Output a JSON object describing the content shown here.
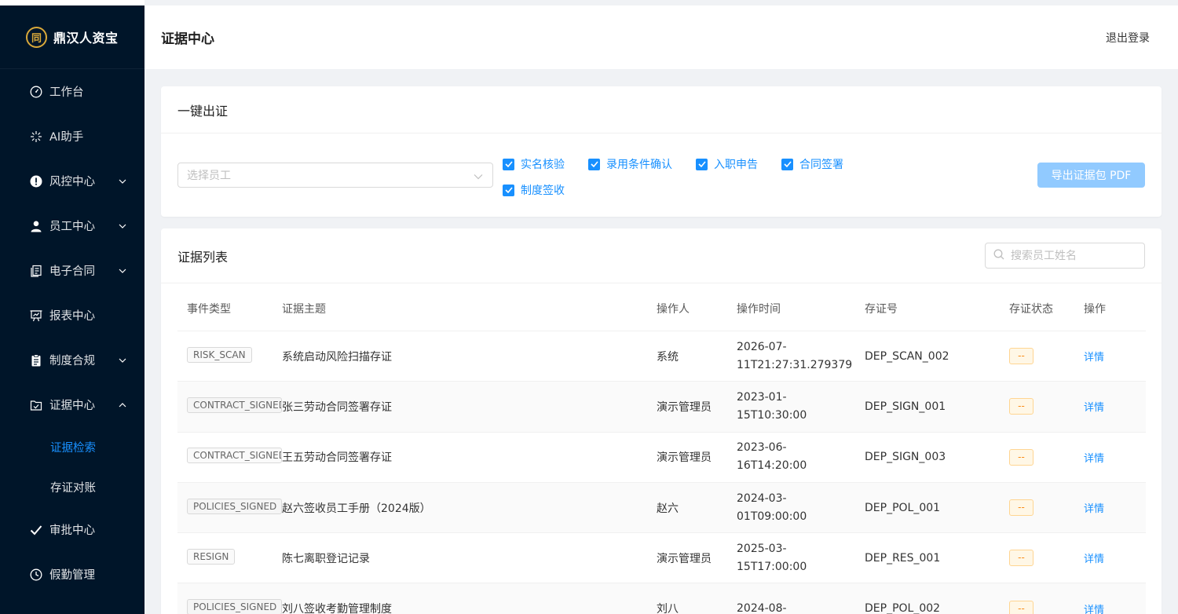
{
  "brand": {
    "logo_char": "同",
    "name": "鼎汉人资宝"
  },
  "sidebar": {
    "items": [
      {
        "label": "工作台",
        "icon": "dashboard-icon"
      },
      {
        "label": "AI助手",
        "icon": "sparkle-icon"
      },
      {
        "label": "风控中心",
        "icon": "alert-circle-icon"
      },
      {
        "label": "员工中心",
        "icon": "user-icon"
      },
      {
        "label": "电子合同",
        "icon": "contract-icon"
      },
      {
        "label": "报表中心",
        "icon": "report-icon"
      },
      {
        "label": "制度合规",
        "icon": "clipboard-icon"
      },
      {
        "label": "证据中心",
        "icon": "evidence-icon"
      },
      {
        "label": "审批中心",
        "icon": "check-icon"
      },
      {
        "label": "假勤管理",
        "icon": "clock-icon"
      }
    ],
    "sub": {
      "search": "证据检索",
      "ledger": "存证对账"
    }
  },
  "header": {
    "title": "证据中心",
    "logout": "退出登录"
  },
  "issue": {
    "title": "一键出证",
    "select_placeholder": "选择员工",
    "checks": [
      "实名核验",
      "录用条件确认",
      "入职申告",
      "合同签署",
      "制度签收"
    ],
    "export": "导出证据包 PDF"
  },
  "list": {
    "title": "证据列表",
    "search_placeholder": "搜索员工姓名",
    "columns": [
      "事件类型",
      "证据主题",
      "操作人",
      "操作时间",
      "存证号",
      "存证状态",
      "操作"
    ],
    "rows": [
      {
        "type": "RISK_SCAN",
        "subject": "系统启动风险扫描存证",
        "operator": "系统",
        "time1": "2026-07-",
        "time2": "11T21:27:31.279379",
        "id": "DEP_SCAN_002",
        "status": "--",
        "action": "详情"
      },
      {
        "type": "CONTRACT_SIGNED",
        "subject": "张三劳动合同签署存证",
        "operator": "演示管理员",
        "time1": "2023-01-",
        "time2": "15T10:30:00",
        "id": "DEP_SIGN_001",
        "status": "--",
        "action": "详情"
      },
      {
        "type": "CONTRACT_SIGNED",
        "subject": "王五劳动合同签署存证",
        "operator": "演示管理员",
        "time1": "2023-06-",
        "time2": "16T14:20:00",
        "id": "DEP_SIGN_003",
        "status": "--",
        "action": "详情"
      },
      {
        "type": "POLICIES_SIGNED",
        "subject": "赵六签收员工手册（2024版）",
        "operator": "赵六",
        "time1": "2024-03-",
        "time2": "01T09:00:00",
        "id": "DEP_POL_001",
        "status": "--",
        "action": "详情"
      },
      {
        "type": "RESIGN",
        "subject": "陈七离职登记记录",
        "operator": "演示管理员",
        "time1": "2025-03-",
        "time2": "15T17:00:00",
        "id": "DEP_RES_001",
        "status": "--",
        "action": "详情"
      },
      {
        "type": "POLICIES_SIGNED",
        "subject": "刘八签收考勤管理制度",
        "operator": "刘八",
        "time1": "2024-08-",
        "time2": "",
        "id": "DEP_POL_002",
        "status": "--",
        "action": "详情"
      }
    ]
  },
  "colors": {
    "sidebar_bg": "#001529",
    "primary": "#1890ff",
    "brand_gold": "#d9a93a",
    "status_orange": "#fa8c16"
  }
}
